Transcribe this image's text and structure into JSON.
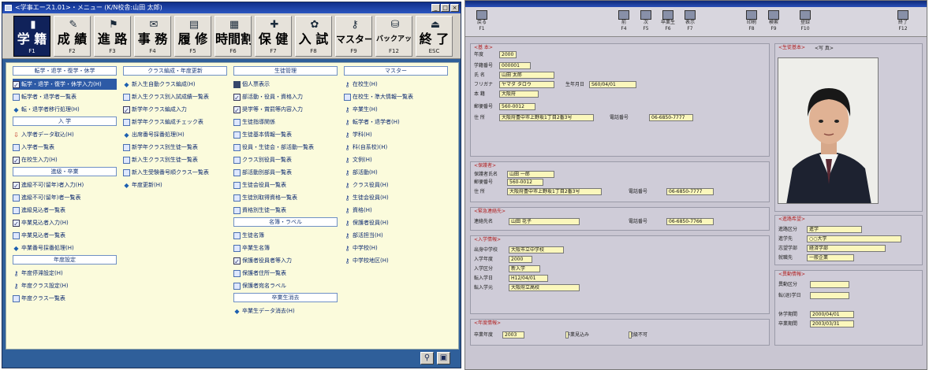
{
  "left_window": {
    "title": "<学事エース1.01>・メニュー  (K/N校舎:山田 太郎)",
    "title_buttons": [
      "_",
      "□",
      "×"
    ],
    "toolbar": [
      {
        "label": "学 籍",
        "key": "F1",
        "icon": "student-register-icon",
        "active": true
      },
      {
        "label": "成 績",
        "key": "F2",
        "icon": "grades-icon"
      },
      {
        "label": "進 路",
        "key": "F3",
        "icon": "career-icon"
      },
      {
        "label": "事 務",
        "key": "F4",
        "icon": "office-icon"
      },
      {
        "label": "履 修",
        "key": "F5",
        "icon": "course-icon"
      },
      {
        "label": "時間割",
        "key": "F6",
        "icon": "timetable-icon"
      },
      {
        "label": "保 健",
        "key": "F7",
        "icon": "health-icon"
      },
      {
        "label": "入 試",
        "key": "F8",
        "icon": "exam-icon"
      },
      {
        "label": "マスター",
        "key": "F9",
        "icon": "master-icon"
      },
      {
        "label": "バックアップ",
        "key": "F12",
        "icon": "backup-icon"
      },
      {
        "label": "終 了",
        "key": "ESC",
        "icon": "exit-icon"
      }
    ],
    "columns": [
      {
        "sections": [
          {
            "header": "転学・退学・復学・休学",
            "items": [
              {
                "label": "転学・退学・復学・休学入力(H)",
                "icon": "check",
                "selected": true
              },
              {
                "label": "転学者・退学者一覧表",
                "icon": "doc"
              },
              {
                "label": "転・退学者移行処理(H)",
                "icon": "diamond"
              }
            ]
          },
          {
            "header": "入 学",
            "items": [
              {
                "label": "入学者データ取込(H)",
                "icon": "arrow"
              },
              {
                "label": "入学者一覧表",
                "icon": "doc"
              },
              {
                "label": "在校生入力(H)",
                "icon": "check"
              }
            ]
          },
          {
            "header": "進級・卒業",
            "items": [
              {
                "label": "進級不可(留年)者入力(H)",
                "icon": "check"
              },
              {
                "label": "進級不可(留年)者一覧表",
                "icon": "doc"
              },
              {
                "label": "進級見込者一覧表",
                "icon": "doc"
              },
              {
                "label": "卒業見込者入力(H)",
                "icon": "check"
              },
              {
                "label": "卒業見込者一覧表",
                "icon": "doc"
              },
              {
                "label": "卒業番号採番処理(H)",
                "icon": "diamond"
              }
            ]
          },
          {
            "header": "年度設定",
            "items": [
              {
                "label": "年度停滞設定(H)",
                "icon": "key"
              },
              {
                "label": "年度クラス設定(H)",
                "icon": "key"
              },
              {
                "label": "年度クラス一覧表",
                "icon": "doc"
              }
            ]
          }
        ]
      },
      {
        "sections": [
          {
            "header": "クラス編成・年度更新",
            "items": [
              {
                "label": "新入生自動クラス編成(H)",
                "icon": "diamond"
              },
              {
                "label": "新入生クラス別入試成績一覧表",
                "icon": "doc"
              },
              {
                "label": "新学年クラス編成入力",
                "icon": "check"
              },
              {
                "label": "新学年クラス編成チェック表",
                "icon": "doc"
              },
              {
                "label": "出席番号採番処理(H)",
                "icon": "diamond"
              },
              {
                "label": "新学年クラス別生徒一覧表",
                "icon": "doc"
              },
              {
                "label": "新入生クラス別生徒一覧表",
                "icon": "doc"
              },
              {
                "label": "新入生受験番号順クラス一覧表",
                "icon": "doc"
              },
              {
                "label": "年度更新(H)",
                "icon": "diamond"
              }
            ]
          }
        ]
      },
      {
        "sections": [
          {
            "header": "生徒管理",
            "items": [
              {
                "label": "個人票表示",
                "icon": "block"
              },
              {
                "label": "部活動・役員・資格入力",
                "icon": "check"
              },
              {
                "label": "奨学等・賞罰等内容入力",
                "icon": "check"
              },
              {
                "label": "生徒指導関係",
                "icon": "doc"
              },
              {
                "label": "生徒基本情報一覧表",
                "icon": "doc"
              },
              {
                "label": "役員・生徒会・部活動一覧表",
                "icon": "doc"
              },
              {
                "label": "クラス別役員一覧表",
                "icon": "doc"
              },
              {
                "label": "部活動別部員一覧表",
                "icon": "doc"
              },
              {
                "label": "生徒会役員一覧表",
                "icon": "doc"
              },
              {
                "label": "生徒別取得資格一覧表",
                "icon": "doc"
              },
              {
                "label": "資格別生徒一覧表",
                "icon": "doc"
              }
            ]
          },
          {
            "header": "名簿・ラベル",
            "items": [
              {
                "label": "生徒名簿",
                "icon": "doc"
              },
              {
                "label": "卒業生名簿",
                "icon": "doc"
              },
              {
                "label": "保護者役員者等入力",
                "icon": "check"
              },
              {
                "label": "保護者住所一覧表",
                "icon": "doc"
              },
              {
                "label": "保護者宛名ラベル",
                "icon": "doc"
              }
            ]
          },
          {
            "header": "卒業生消去",
            "items": [
              {
                "label": "卒業生データ消去(H)",
                "icon": "diamond"
              }
            ]
          }
        ]
      },
      {
        "sections": [
          {
            "header": "マスター",
            "items": [
              {
                "label": "在校生(H)",
                "icon": "key"
              },
              {
                "label": "在校生・準大情報一覧表",
                "icon": "doc"
              },
              {
                "label": "卒業生(H)",
                "icon": "key"
              },
              {
                "label": "転学者・退学者(H)",
                "icon": "key"
              },
              {
                "label": "学科(H)",
                "icon": "key"
              },
              {
                "label": "科(自系校)(H)",
                "icon": "key"
              },
              {
                "label": "文例(H)",
                "icon": "key"
              },
              {
                "label": "部活動(H)",
                "icon": "key"
              },
              {
                "label": "クラス役員(H)",
                "icon": "key"
              },
              {
                "label": "生徒会役員(H)",
                "icon": "key"
              },
              {
                "label": "資格(H)",
                "icon": "key"
              },
              {
                "label": "保護者役員(H)",
                "icon": "key"
              },
              {
                "label": "部活担当(H)",
                "icon": "key"
              },
              {
                "label": "中学校(H)",
                "icon": "key"
              },
              {
                "label": "中学校地区(H)",
                "icon": "key"
              }
            ]
          }
        ]
      }
    ],
    "bottom_buttons": [
      {
        "name": "binoculars-icon",
        "glyph": "⚲"
      },
      {
        "name": "window-icon",
        "glyph": "▣"
      }
    ]
  },
  "right_window": {
    "toolbar": [
      {
        "label": "戻る",
        "key": "F1",
        "icon": "back-icon"
      },
      {
        "label": "前",
        "key": "F4",
        "icon": "prev-icon"
      },
      {
        "label": "次",
        "key": "F5",
        "icon": "next-icon"
      },
      {
        "label": "卒業生",
        "key": "F6",
        "icon": "graduate-icon"
      },
      {
        "label": "表示",
        "key": "F7",
        "icon": "display-icon"
      },
      {
        "label": "印刷",
        "key": "F8",
        "icon": "print-icon"
      },
      {
        "label": "検索",
        "key": "F9",
        "icon": "search-icon"
      },
      {
        "label": "登録",
        "key": "F10",
        "icon": "register-icon"
      },
      {
        "label": "終了",
        "key": "F12",
        "icon": "exit-icon"
      }
    ],
    "tabs": [
      "<生徒基本>",
      "<写 真>"
    ],
    "basic_title": "<基 本>",
    "basic_fields": [
      {
        "label": "年度",
        "value": "2000"
      },
      {
        "label": "学籍番号",
        "value": "000001"
      },
      {
        "label": "氏 名",
        "value": "山田 太郎"
      },
      {
        "label": "フリガナ",
        "value": "ヤマダ タロウ"
      },
      {
        "label": "生年月日",
        "value": "S60/04/01"
      },
      {
        "label": "本 籍",
        "value": "大阪府"
      },
      {
        "label": "郵便番号",
        "value": "560-0012"
      },
      {
        "label": "住 所",
        "value": "大阪府豊中市上野坂1丁目2番3号"
      },
      {
        "label": "電話番号",
        "value": "06-6850-7777"
      }
    ],
    "guardian_title": "<保護者>",
    "guardian_fields": [
      {
        "label": "保護者氏名",
        "value": "山田 一郎"
      },
      {
        "label": "郵便番号",
        "value": "560-0012"
      },
      {
        "label": "住 所",
        "value": "大阪府豊中市上野坂1丁目2番3号"
      },
      {
        "label": "電話番号",
        "value": "06-6850-7777"
      }
    ],
    "emergency_title": "<緊急連絡先>",
    "emergency_fields": [
      {
        "label": "連絡先名",
        "value": "山田 花子"
      },
      {
        "label": "電話番号",
        "value": "06-6850-7766"
      }
    ],
    "entry_title": "<入学情報>",
    "entry_fields": [
      {
        "label": "出身中学校",
        "value": "大阪市立中学校"
      },
      {
        "label": "入学年度",
        "value": "2000"
      },
      {
        "label": "入学区分",
        "value": "新入学"
      },
      {
        "label": "転入学日",
        "value": "H12/04/01"
      },
      {
        "label": "転入学元",
        "value": "大阪府立高校"
      }
    ],
    "year_title": "<年度情報>",
    "year_fields": [
      {
        "label": "卒業年度",
        "value": "2003"
      },
      {
        "label": "卒業見込み",
        "value": "卒業見込み"
      },
      {
        "label": "進級不可",
        "value": "進級不可(留年)"
      }
    ],
    "course_title": "<進路希望>",
    "course_fields": [
      {
        "label": "進路区分",
        "value": "進学"
      },
      {
        "label": "進学先",
        "value": "○○大学"
      },
      {
        "label": "志望学部",
        "value": "経済学部"
      },
      {
        "label": "就職先",
        "value": "一般企業"
      }
    ],
    "exit_title": "<異動情報>",
    "exit_fields": [
      {
        "label": "異動区分",
        "value": ""
      },
      {
        "label": "転(退)学日",
        "value": ""
      },
      {
        "label": "休学期間",
        "value": "2000/04/01"
      },
      {
        "label": "卒業期間",
        "value": "2003/03/31"
      }
    ]
  }
}
